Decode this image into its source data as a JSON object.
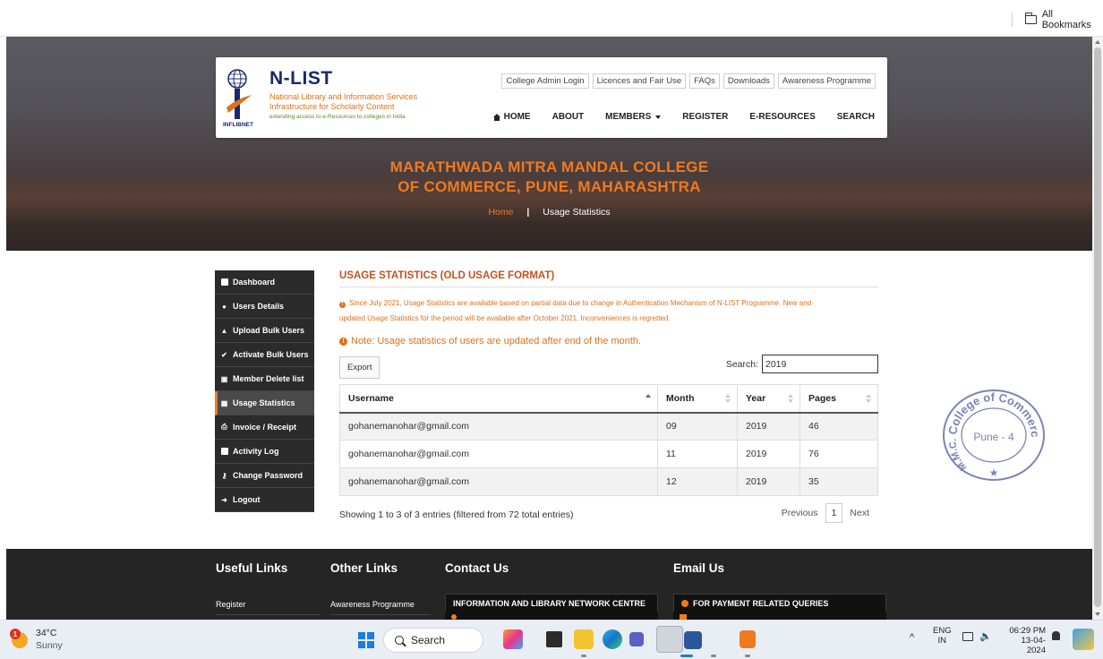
{
  "browser": {
    "bookmarks_label": "All Bookmarks"
  },
  "site": {
    "logo_name": "N-LIST",
    "logo_sub1": "National Library and Information Services",
    "logo_sub2": "Infrastructure for Scholarly Content",
    "logo_tagline": "extending access to e-Resources to colleges in India",
    "logo_org": "INFLIBNET",
    "top_links": [
      "College Admin Login",
      "Licences and Fair Use",
      "FAQs",
      "Downloads",
      "Awareness Programme"
    ],
    "nav": {
      "home": "HOME",
      "about": "ABOUT",
      "members": "MEMBERS",
      "register": "REGISTER",
      "eresources": "E-RESOURCES",
      "search": "SEARCH"
    },
    "college_line1": "MARATHWADA MITRA MANDAL COLLEGE",
    "college_line2": "OF COMMERCE, PUNE, MAHARASHTRA",
    "breadcrumb_home": "Home",
    "breadcrumb_current": "Usage Statistics"
  },
  "sidebar": {
    "items": [
      {
        "label": "Dashboard",
        "icon": "dashboard-icon"
      },
      {
        "label": "Users Details",
        "icon": "users-icon"
      },
      {
        "label": "Upload Bulk Users",
        "icon": "upload-users-icon"
      },
      {
        "label": "Activate Bulk Users",
        "icon": "check-square-icon"
      },
      {
        "label": "Member Delete list",
        "icon": "trash-icon"
      },
      {
        "label": "Usage Statistics",
        "icon": "bar-chart-icon"
      },
      {
        "label": "Invoice / Receipt",
        "icon": "printer-icon"
      },
      {
        "label": "Activity Log",
        "icon": "list-icon"
      },
      {
        "label": "Change Password",
        "icon": "key-icon"
      },
      {
        "label": "Logout",
        "icon": "logout-icon"
      }
    ],
    "active_index": 5
  },
  "main": {
    "title": "USAGE STATISTICS (OLD USAGE FORMAT)",
    "notice_line1": "Since July 2021, Usage Statistics are available based on partial data due to change in Authentication Mechanism of N-LIST Programme. New and",
    "notice_line2": "updated Usage Statistics for the period will be available after October 2021. Inconveniences is regretted.",
    "note": "Note: Usage statistics of users are updated after end of the month.",
    "export_label": "Export",
    "search_label": "Search:",
    "search_value": "2019",
    "table": {
      "headers": [
        "Username",
        "Month",
        "Year",
        "Pages"
      ],
      "rows": [
        [
          "gohanemanohar@gmail.com",
          "09",
          "2019",
          "46"
        ],
        [
          "gohanemanohar@gmail.com",
          "11",
          "2019",
          "76"
        ],
        [
          "gohanemanohar@gmail.com",
          "12",
          "2019",
          "35"
        ]
      ]
    },
    "info": "Showing 1 to 3 of 3 entries (filtered from 72 total entries)",
    "pager": {
      "previous": "Previous",
      "page": "1",
      "next": "Next"
    }
  },
  "stamp": {
    "top_text": "College of Commerce",
    "left_text": "M.M.C.C.",
    "center": "Pune - 4"
  },
  "footer": {
    "useful_links": "Useful Links",
    "other_links": "Other Links",
    "contact_us": "Contact Us",
    "email_us": "Email Us",
    "useful_item": "Register",
    "other_item": "Awareness Programme",
    "contact_box": "INFORMATION AND LIBRARY NETWORK CENTRE",
    "email_box": "FOR PAYMENT RELATED QUERIES"
  },
  "taskbar": {
    "temp": "34°C",
    "weather": "Sunny",
    "weather_badge": "1",
    "search": "Search",
    "lang1": "ENG",
    "lang2": "IN",
    "time": "06:29 PM",
    "date": "13-04-2024"
  },
  "colors": {
    "accent": "#f07a1e",
    "title": "#c8501e",
    "sidebar_bg": "#2b2b2b",
    "footer_bg": "#252525"
  }
}
